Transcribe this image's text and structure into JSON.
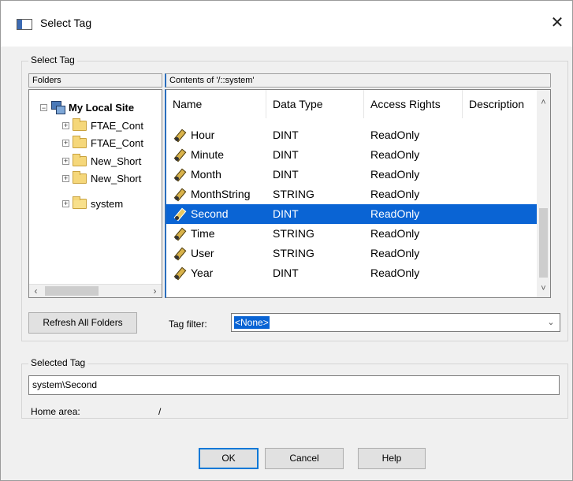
{
  "window": {
    "title": "Select Tag",
    "close_glyph": "✕"
  },
  "select_group": {
    "label": "Select Tag"
  },
  "folders": {
    "header": "Folders",
    "tree": [
      {
        "label": "My Local Site",
        "expander": "⊟",
        "icon": "site-icon",
        "bold": true
      },
      {
        "label": "FTAE_Cont",
        "expander": "+",
        "icon": "folder-icon"
      },
      {
        "label": "FTAE_Cont",
        "expander": "+",
        "icon": "folder-icon"
      },
      {
        "label": "New_Short",
        "expander": "+",
        "icon": "folder-icon"
      },
      {
        "label": "New_Short",
        "expander": "+",
        "icon": "folder-icon"
      },
      {
        "label": "system",
        "expander": "+",
        "icon": "open-folder-icon"
      }
    ],
    "scroll_left": "‹",
    "scroll_right": "›"
  },
  "contents": {
    "header": "Contents of '/::system'",
    "columns": [
      "Name",
      "Data Type",
      "Access Rights",
      "Description"
    ],
    "rows": [
      {
        "name": "Hour",
        "type": "DINT",
        "access": "ReadOnly",
        "desc": ""
      },
      {
        "name": "Minute",
        "type": "DINT",
        "access": "ReadOnly",
        "desc": ""
      },
      {
        "name": "Month",
        "type": "DINT",
        "access": "ReadOnly",
        "desc": ""
      },
      {
        "name": "MonthString",
        "type": "STRING",
        "access": "ReadOnly",
        "desc": ""
      },
      {
        "name": "Second",
        "type": "DINT",
        "access": "ReadOnly",
        "desc": "",
        "selected": true
      },
      {
        "name": "Time",
        "type": "STRING",
        "access": "ReadOnly",
        "desc": ""
      },
      {
        "name": "User",
        "type": "STRING",
        "access": "ReadOnly",
        "desc": ""
      },
      {
        "name": "Year",
        "type": "DINT",
        "access": "ReadOnly",
        "desc": ""
      }
    ],
    "scroll_up": "˄",
    "scroll_down": "˅",
    "selected_color": "#0a64d4"
  },
  "toolbar": {
    "refresh_label": "Refresh All Folders",
    "tag_filter_label": "Tag filter:",
    "tag_filter_value": "<None>",
    "dropdown_glyph": "⌄"
  },
  "selected_group": {
    "label": "Selected Tag",
    "value": "system\\Second",
    "home_area_label": "Home area:",
    "home_area_value": "/"
  },
  "buttons": {
    "ok": "OK",
    "cancel": "Cancel",
    "help": "Help"
  }
}
